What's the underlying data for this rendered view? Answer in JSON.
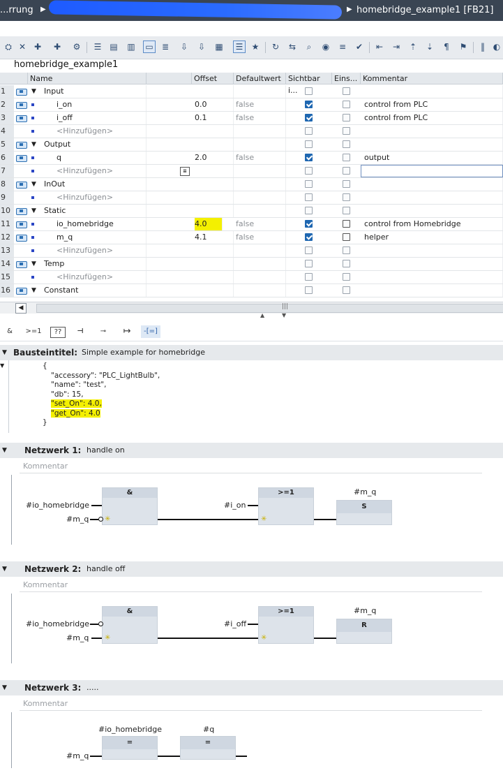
{
  "titlebar": {
    "left_crumb": "...rrung",
    "right_crumb": "homebridge_example1 [FB21]"
  },
  "editor": {
    "block_name": "homebridge_example1"
  },
  "table": {
    "headers": [
      "Name",
      "Offset",
      "Defaultwert",
      "Sichtbar i...",
      "Eins...",
      "Kommentar"
    ],
    "rows": [
      {
        "num": "1",
        "name": "Input",
        "offset": "",
        "default": "",
        "visible": false,
        "eins": false,
        "comment": "",
        "type": "section"
      },
      {
        "num": "2",
        "name": "i_on",
        "offset": "0.0",
        "default": "false",
        "visible": true,
        "eins": false,
        "comment": "control from PLC",
        "type": "var"
      },
      {
        "num": "3",
        "name": "i_off",
        "offset": "0.1",
        "default": "false",
        "visible": true,
        "eins": false,
        "comment": "control from PLC",
        "type": "var"
      },
      {
        "num": "4",
        "name": "<Hinzufügen>",
        "offset": "",
        "default": "",
        "visible": false,
        "eins": false,
        "comment": "",
        "type": "add"
      },
      {
        "num": "5",
        "name": "Output",
        "offset": "",
        "default": "",
        "visible": false,
        "eins": false,
        "comment": "",
        "type": "section"
      },
      {
        "num": "6",
        "name": "q",
        "offset": "2.0",
        "default": "false",
        "visible": true,
        "eins": false,
        "comment": "output",
        "type": "var"
      },
      {
        "num": "7",
        "name": "<Hinzufügen>",
        "offset": "",
        "default": "",
        "visible": false,
        "eins": false,
        "comment": "",
        "type": "add"
      },
      {
        "num": "8",
        "name": "InOut",
        "offset": "",
        "default": "",
        "visible": false,
        "eins": false,
        "comment": "",
        "type": "section"
      },
      {
        "num": "9",
        "name": "<Hinzufügen>",
        "offset": "",
        "default": "",
        "visible": false,
        "eins": false,
        "comment": "",
        "type": "add"
      },
      {
        "num": "10",
        "name": "Static",
        "offset": "",
        "default": "",
        "visible": false,
        "eins": false,
        "comment": "",
        "type": "section"
      },
      {
        "num": "11",
        "name": "io_homebridge",
        "offset": "4.0",
        "default": "false",
        "visible": true,
        "eins": false,
        "comment": "control from Homebridge",
        "type": "var"
      },
      {
        "num": "12",
        "name": "m_q",
        "offset": "4.1",
        "default": "false",
        "visible": true,
        "eins": false,
        "comment": "helper",
        "type": "var"
      },
      {
        "num": "13",
        "name": "<Hinzufügen>",
        "offset": "",
        "default": "",
        "visible": false,
        "eins": false,
        "comment": "",
        "type": "add"
      },
      {
        "num": "14",
        "name": "Temp",
        "offset": "",
        "default": "",
        "visible": false,
        "eins": false,
        "comment": "",
        "type": "section"
      },
      {
        "num": "15",
        "name": "<Hinzufügen>",
        "offset": "",
        "default": "",
        "visible": false,
        "eins": false,
        "comment": "",
        "type": "add"
      },
      {
        "num": "16",
        "name": "Constant",
        "offset": "",
        "default": "",
        "visible": false,
        "eins": false,
        "comment": "",
        "type": "section"
      }
    ]
  },
  "instruction_bar": [
    "&",
    ">=1",
    "??",
    "⊣",
    "⊸",
    "↦",
    "-[=]"
  ],
  "block_title": {
    "label": "Bausteintitel:",
    "text": "Simple example for homebridge"
  },
  "block_comment_lines": [
    "{",
    "\"accessory\": \"PLC_LightBulb\",",
    "\"name\": \"test\",",
    "\"db\": 15,",
    "\"set_On\": 4.0,",
    "\"get_On\": 4.0",
    "}"
  ],
  "networks": [
    {
      "label": "Netzwerk 1:",
      "title": "handle on",
      "comment": "Kommentar",
      "and_head": "&",
      "or_head": ">=1",
      "coil_head": "S",
      "in1": "#io_homebridge",
      "in2": "#m_q",
      "or_in": "#i_on",
      "coil_tag": "#m_q"
    },
    {
      "label": "Netzwerk 2:",
      "title": "handle off",
      "comment": "Kommentar",
      "and_head": "&",
      "or_head": ">=1",
      "coil_head": "R",
      "in1": "#io_homebridge",
      "in2": "#m_q",
      "or_in": "#i_off",
      "coil_tag": "#m_q"
    },
    {
      "label": "Netzwerk 3:",
      "title": ".....",
      "comment": "Kommentar",
      "box1_head": "=",
      "box2_head": "=",
      "box1_tag": "#io_homebridge",
      "box2_tag": "#q",
      "in": "#m_q"
    }
  ]
}
